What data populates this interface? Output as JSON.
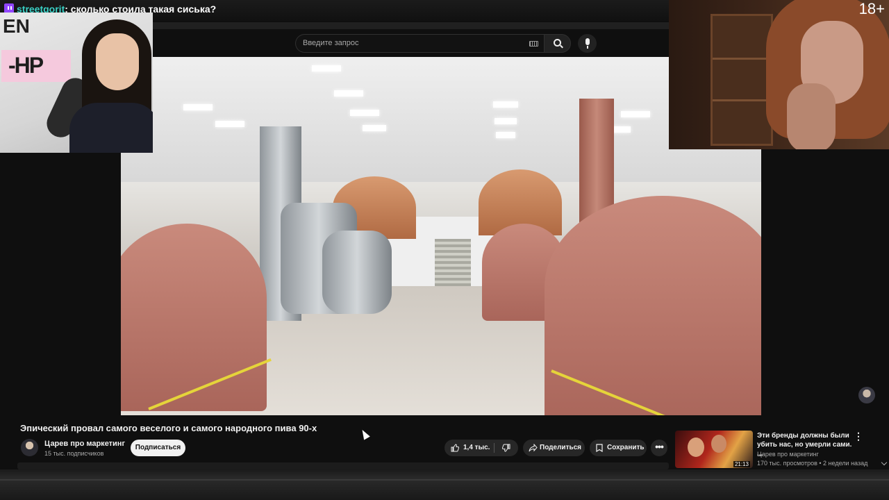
{
  "chat": {
    "username": "streetgorit",
    "separator": ":",
    "message": " сколько стоила такая сиська?"
  },
  "overlay": {
    "age_badge": "18+"
  },
  "search": {
    "placeholder": "Введите запрос"
  },
  "video": {
    "title": "Эпический провал самого веселого и самого народного пива 90-х"
  },
  "channel": {
    "name": "Царев про маркетинг",
    "subscribers": "15 тыс. подписчиков",
    "subscribe_label": "Подписаться"
  },
  "actions": {
    "likes": "1,4 тыс.",
    "share_label": "Поделиться",
    "save_label": "Сохранить",
    "more_label": "•••"
  },
  "recommended": {
    "title": "Эти бренды должны были убить нас, но умерли сами. ...",
    "channel": "Царев про маркетинг",
    "meta": "170 тыс. просмотров • 2 недели назад",
    "duration": "21:13",
    "menu_label": "⋮"
  },
  "colors": {
    "accent_twitch": "#9146ff",
    "chat_username": "#3ad1c6",
    "background": "#0f0f0f"
  }
}
